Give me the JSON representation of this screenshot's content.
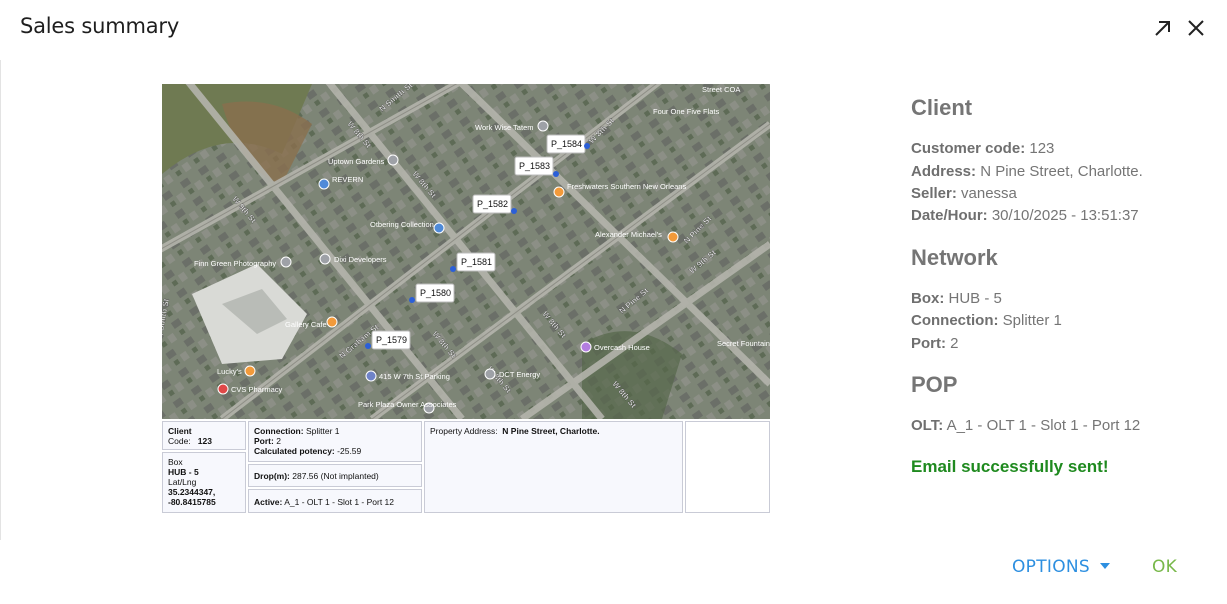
{
  "dialog": {
    "title": "Sales summary",
    "icons": {
      "expand": "arrow-up-right-icon",
      "close": "close-icon"
    }
  },
  "map": {
    "streets": [
      "W 8th St",
      "N Smith St",
      "W 8th St",
      "W 9th St",
      "W 8th St",
      "N Graham St",
      "W 8th St",
      "N Pine St",
      "W 9th St",
      "W 8th St",
      "N Smith St",
      "W 8th St",
      "W 8th St",
      "N Pine St"
    ],
    "places": [
      "Work Wise Tatem",
      "Uptown Gardens",
      "REVERN",
      "Freshwaters Southern New Orleans",
      "Alexander Michael's",
      "Otbering Collection",
      "Finn Green Photography",
      "Dixi Developers",
      "Gallery Cafe",
      "Overcash House",
      "Secret Fountain",
      "CVS Pharmacy",
      "Lucky's",
      "415 W 7th St Parking",
      "DCT Energy",
      "Park Plaza Owner Associates",
      "Four One Five Flats",
      "Street COA"
    ],
    "poles": [
      "P_1584",
      "P_1583",
      "P_1582",
      "P_1581",
      "P_1580",
      "P_1579"
    ]
  },
  "info": {
    "client_label": "Client",
    "code_label": "Code:",
    "code_value": "123",
    "box_label": "Box",
    "box_value": "HUB - 5",
    "latlng_label": "Lat/Lng",
    "lat": "35.2344347,",
    "lng": "-80.8415785",
    "connection_label": "Connection:",
    "connection_value": "Splitter 1",
    "port_label": "Port:",
    "port_value": "2",
    "potency_label": "Calculated potency:",
    "potency_value": "-25.59",
    "drop_label": "Drop(m):",
    "drop_value": "287.56 (Not implanted)",
    "active_label": "Active:",
    "active_value": "A_1 - OLT 1 - Slot 1 - Port 12",
    "address_label": "Property Address:",
    "address_value": "N Pine Street, Charlotte."
  },
  "panel": {
    "client": {
      "heading": "Client",
      "customer_code_label": "Customer code:",
      "customer_code_value": "123",
      "address_label": "Address:",
      "address_value": "N Pine Street, Charlotte.",
      "seller_label": "Seller:",
      "seller_value": "vanessa",
      "date_label": "Date/Hour:",
      "date_value": "30/10/2025 - 13:51:37"
    },
    "network": {
      "heading": "Network",
      "box_label": "Box:",
      "box_value": "HUB - 5",
      "connection_label": "Connection:",
      "connection_value": "Splitter 1",
      "port_label": "Port:",
      "port_value": "2"
    },
    "pop": {
      "heading": "POP",
      "olt_label": "OLT:",
      "olt_value": "A_1 - OLT 1 - Slot 1 - Port 12"
    },
    "status_message": "Email successfully sent!"
  },
  "actions": {
    "options_label": "OPTIONS",
    "ok_label": "OK"
  },
  "colors": {
    "accent": "#2d8fe0",
    "ok": "#78b84a",
    "success": "#1f8a1f",
    "muted_text": "#757575"
  }
}
